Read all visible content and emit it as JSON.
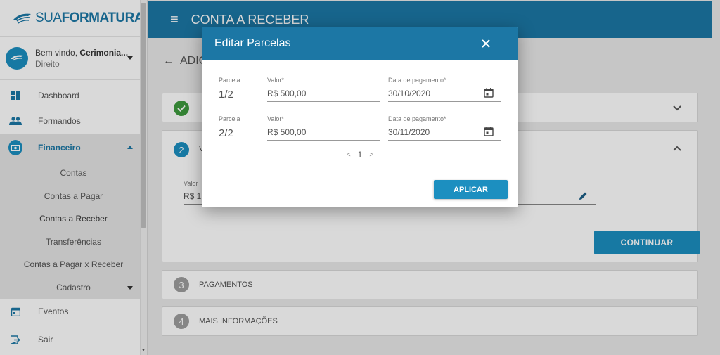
{
  "app": {
    "brand_prefix": "SUA",
    "brand_suffix": "FORMATURA"
  },
  "user": {
    "greeting": "Bem vindo,",
    "name": "Cerimonia...",
    "role": "Direito"
  },
  "sidebar": {
    "items": [
      {
        "label": "Dashboard",
        "icon": "dashboard-icon"
      },
      {
        "label": "Formandos",
        "icon": "people-icon"
      },
      {
        "label": "Financeiro",
        "icon": "money-icon"
      },
      {
        "label": "Eventos",
        "icon": "calendar-icon"
      },
      {
        "label": "Sair",
        "icon": "logout-icon"
      }
    ],
    "submenu": [
      {
        "label": "Contas"
      },
      {
        "label": "Contas a Pagar"
      },
      {
        "label": "Contas a Receber"
      },
      {
        "label": "Transferências"
      },
      {
        "label": "Contas a Pagar x Receber"
      },
      {
        "label": "Cadastro"
      }
    ]
  },
  "topbar": {
    "title": "CONTA A RECEBER"
  },
  "main": {
    "back_label": "ADIC",
    "step1": {
      "letter": "I"
    },
    "step2": {
      "num": "2",
      "letter": "V",
      "valor_caption": "Valor",
      "valor_prefix": "R$ 1"
    },
    "continue_label": "CONTINUAR",
    "step3": {
      "num": "3",
      "label": "PAGAMENTOS"
    },
    "step4": {
      "num": "4",
      "label": "MAIS INFORMAÇÕES"
    }
  },
  "dialog": {
    "title": "Editar Parcelas",
    "rows": [
      {
        "parcela_caption": "Parcela",
        "parcela": "1/2",
        "valor_caption": "Valor*",
        "valor": "R$  500,00",
        "data_caption": "Data de pagamento*",
        "data": "30/10/2020"
      },
      {
        "parcela_caption": "Parcela",
        "parcela": "2/2",
        "valor_caption": "Valor*",
        "valor": "R$  500,00",
        "data_caption": "Data de pagamento*",
        "data": "30/11/2020"
      }
    ],
    "pager": {
      "prev": "<",
      "page": "1",
      "next": ">"
    },
    "apply_label": "APLICAR"
  },
  "colors": {
    "primary": "#1c77a5",
    "accent": "#1c8fc0",
    "success": "#3e9b3e",
    "muted": "#9e9e9e"
  }
}
